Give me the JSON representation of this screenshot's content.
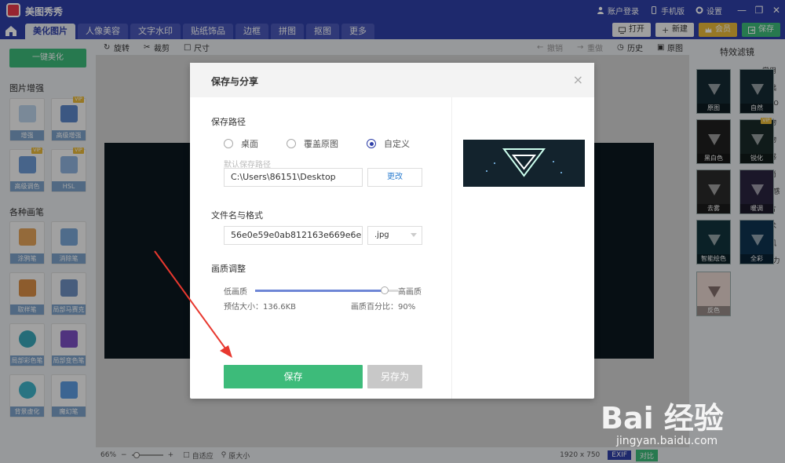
{
  "app": {
    "name": "美图秀秀"
  },
  "titlebar": {
    "account": "账户登录",
    "mobile": "手机版",
    "settings": "设置"
  },
  "tabs": [
    "美化图片",
    "人像美容",
    "文字水印",
    "贴纸饰品",
    "边框",
    "拼图",
    "抠图",
    "更多"
  ],
  "top_buttons": {
    "open": "打开",
    "new": "新建",
    "vip": "会员",
    "save": "保存"
  },
  "toolbar": {
    "rotate": "旋转",
    "crop": "裁剪",
    "size": "尺寸",
    "undo": "撤销",
    "redo": "重做",
    "history": "历史",
    "original": "原图"
  },
  "sidebar": {
    "onekey": "一键美化",
    "enhance_title": "图片增强",
    "enhance": [
      "增强",
      "高级增强",
      "高级调色",
      "HSL"
    ],
    "brush_title": "各种画笔",
    "brushes": [
      "涂鸦笔",
      "消除笔",
      "取样笔",
      "局部马赛克",
      "局部彩色笔",
      "局部变色笔",
      "背景虚化",
      "魔幻笔"
    ],
    "vip": "VIP"
  },
  "filters": {
    "title": "特效滤镜",
    "categories": [
      "常用",
      "基础",
      "LOMO",
      "人物",
      "食物",
      "质感",
      "时尚",
      "电影感",
      "胶片",
      "艺术",
      "国风",
      "男友力"
    ],
    "items": [
      "原图",
      "自然",
      "黑白色",
      "锐化",
      "去雾",
      "暖调",
      "智能绘色",
      "全彩",
      "反色"
    ]
  },
  "statusbar": {
    "zoom": "66%",
    "fit": "自适应",
    "actual": "原大小",
    "dimensions": "1920 x 750",
    "exif": "EXIF",
    "compare": "对比"
  },
  "dialog": {
    "title": "保存与分享",
    "path_section": "保存路径",
    "options": [
      "桌面",
      "覆盖原图",
      "自定义"
    ],
    "default_path_label": "默认保存路径",
    "path_value": "C:\\Users\\86151\\Desktop",
    "change_button": "更改",
    "name_section": "文件名与格式",
    "filename": "56e0e59e0ab812163e669e6e...",
    "format": ".jpg",
    "quality_section": "画质调整",
    "low": "低画质",
    "high": "高画质",
    "size_label": "预估大小：136.6KB",
    "percent_label": "画质百分比：90%",
    "quality_value": 0.9,
    "save": "保存",
    "save_as": "另存为"
  },
  "watermark": {
    "logo": "Bai 经验",
    "url": "jingyan.baidu.com"
  },
  "colors": {
    "brand": "#2f3fa8",
    "green": "#3dbb7a",
    "gold": "#e8b83a"
  }
}
